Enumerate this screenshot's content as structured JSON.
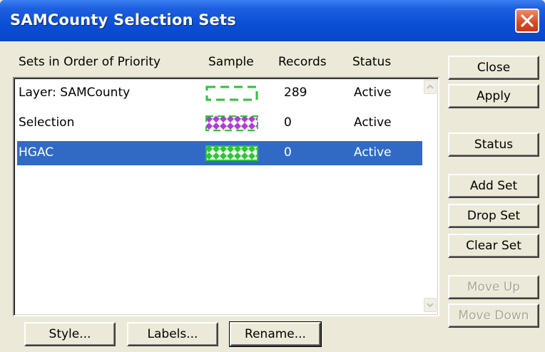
{
  "window": {
    "title": "SAMCounty Selection Sets"
  },
  "columns": {
    "sets": "Sets in Order of Priority",
    "sample": "Sample",
    "records": "Records",
    "status": "Status"
  },
  "rows": [
    {
      "name": "Layer: SAMCounty",
      "records": "289",
      "status": "Active",
      "sample_style": "dashed-green-outline",
      "selected": false
    },
    {
      "name": "Selection",
      "records": "0",
      "status": "Active",
      "sample_style": "purple-diamond-fill",
      "selected": false
    },
    {
      "name": "HGAC",
      "records": "0",
      "status": "Active",
      "sample_style": "green-diamond-fill",
      "selected": true
    }
  ],
  "buttons": {
    "close": "Close",
    "apply": "Apply",
    "status": "Status",
    "add_set": "Add Set",
    "drop_set": "Drop Set",
    "clear_set": "Clear Set",
    "move_up": "Move Up",
    "move_down": "Move Down",
    "style": "Style...",
    "labels": "Labels...",
    "rename": "Rename..."
  },
  "icons": {
    "window_close": "close-x-icon",
    "scroll_up": "scroll-up-arrow-icon",
    "scroll_down": "scroll-down-arrow-icon"
  },
  "colors": {
    "titlebar": "#0a4fd6",
    "selection_highlight": "#316ac5",
    "close_button": "#d84a23",
    "sample_green": "#2fc23a",
    "sample_purple": "#b13ad8"
  }
}
